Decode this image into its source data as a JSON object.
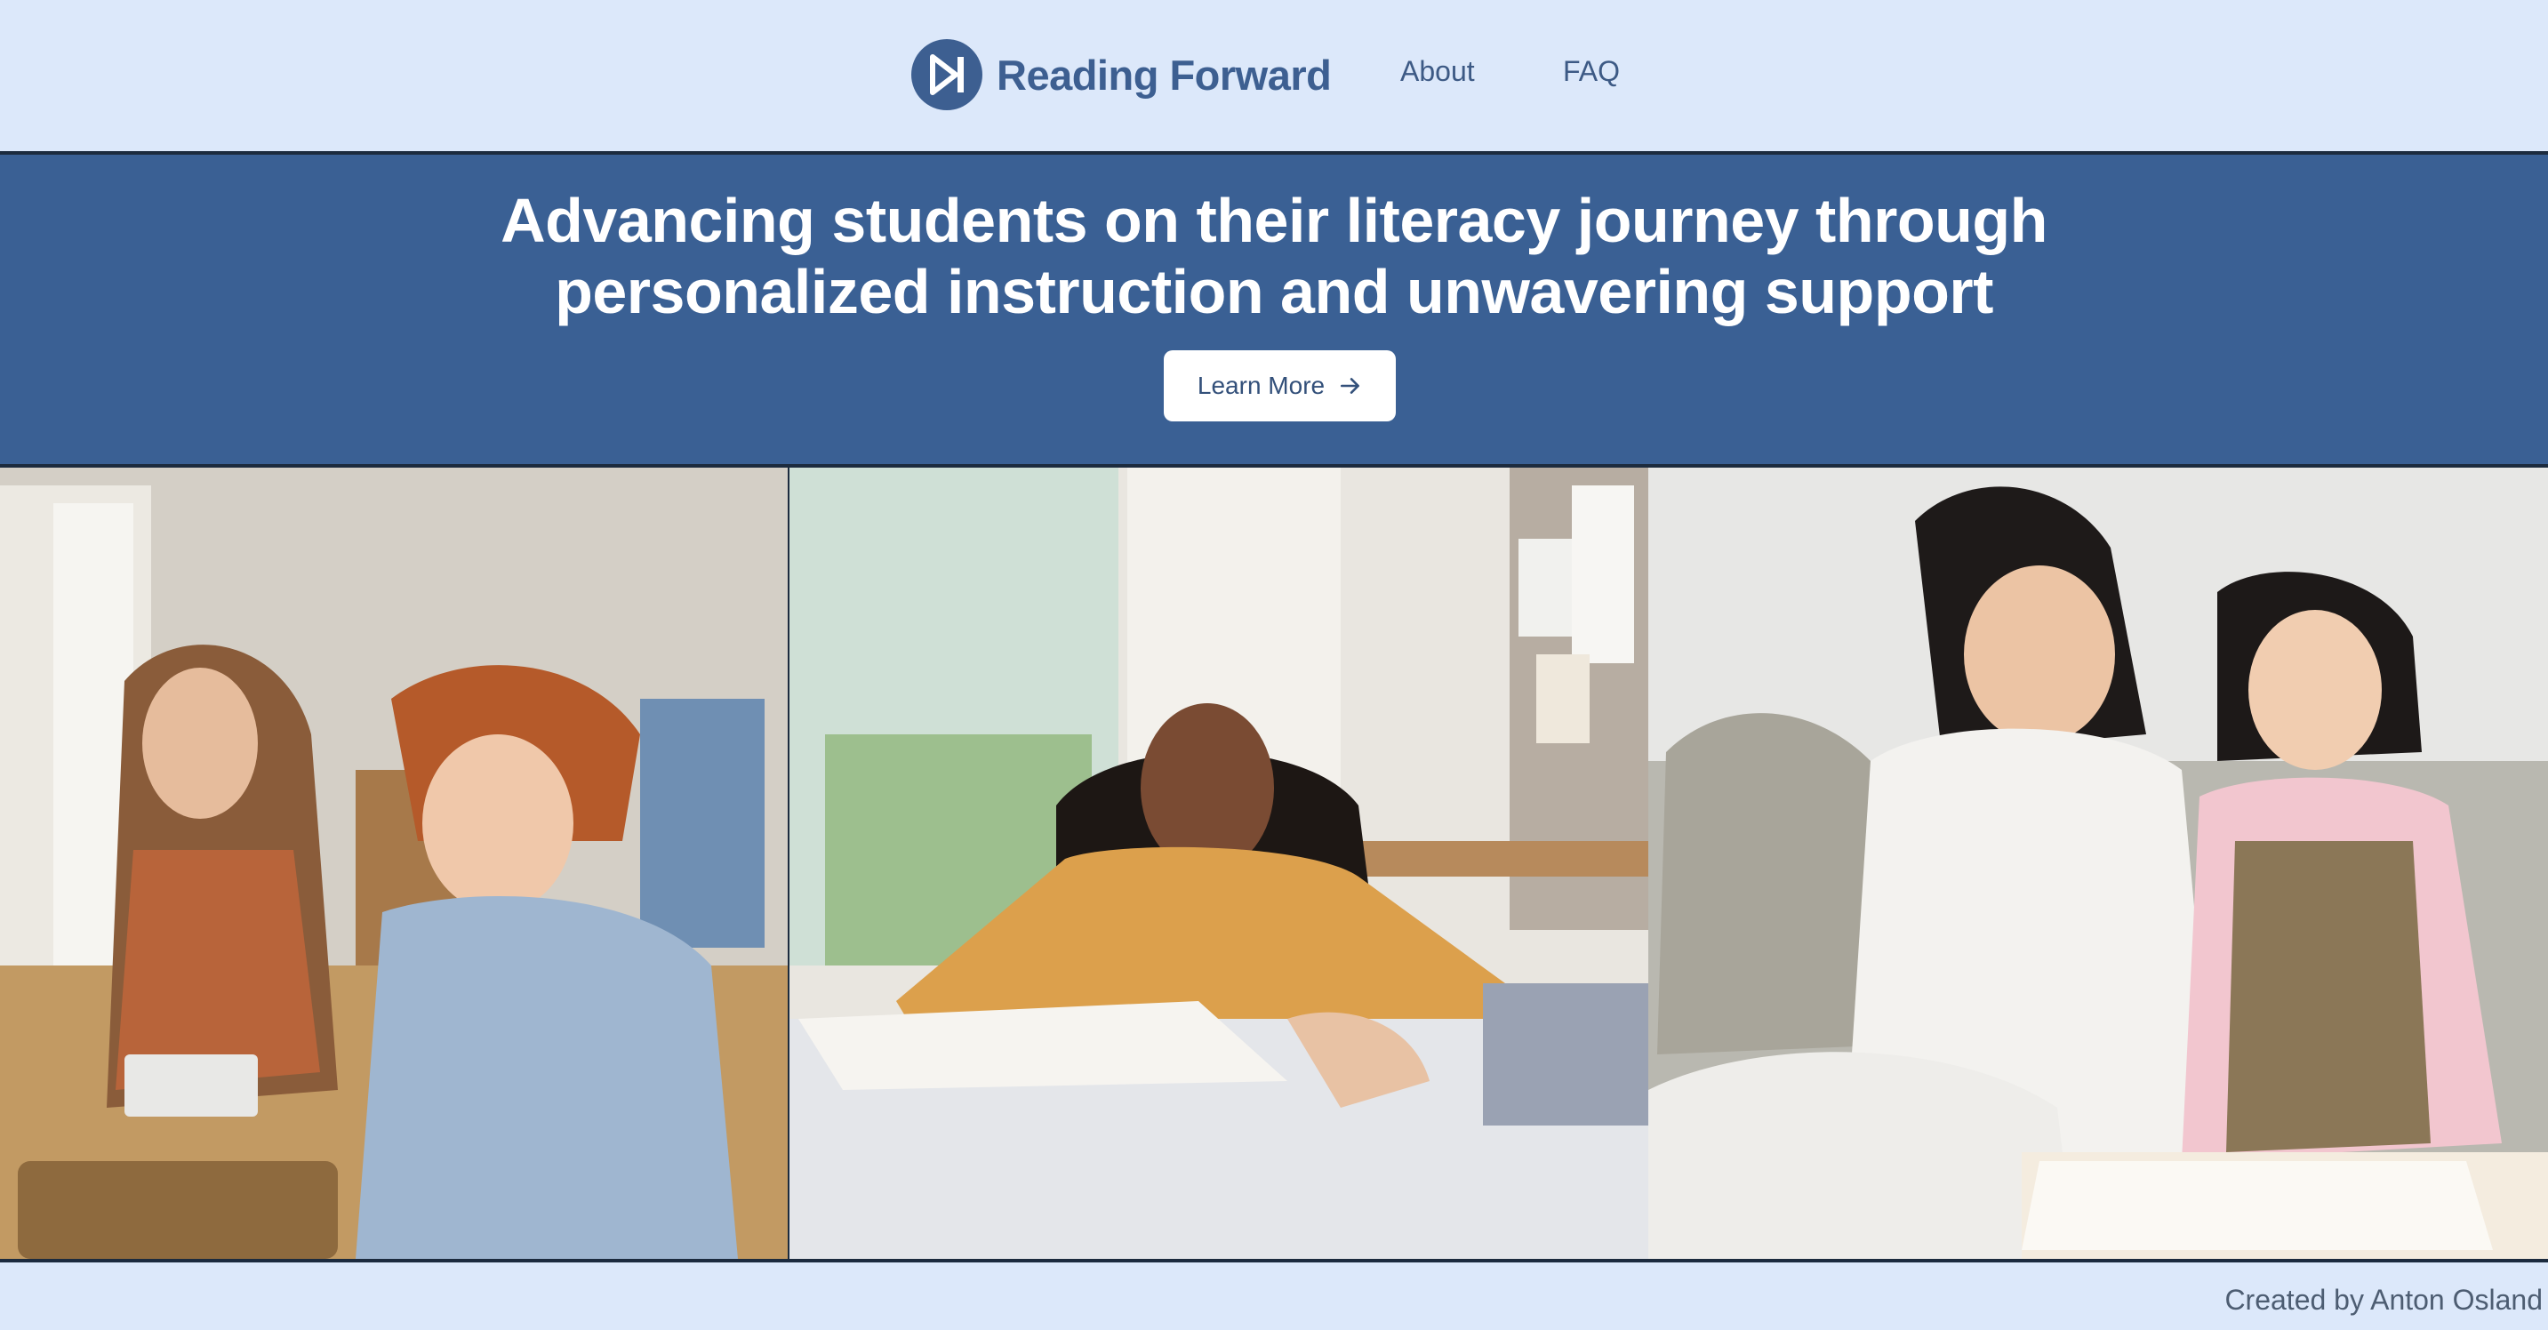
{
  "header": {
    "brand_name": "Reading Forward",
    "logo_icon": "play-skip-forward-icon",
    "nav": [
      {
        "label": "About"
      },
      {
        "label": "FAQ"
      }
    ]
  },
  "hero": {
    "title_line_1": "Advancing students on their literacy journey through",
    "title_line_2": "personalized instruction and unwavering support",
    "cta_label": "Learn More",
    "cta_icon": "arrow-right-icon"
  },
  "photos": [
    {
      "subject": "woman and boy at computer"
    },
    {
      "subject": "student in yellow sweater at table"
    },
    {
      "subject": "woman and girl drawing on couch"
    }
  ],
  "footer": {
    "credit": "Created by Anton Osland"
  },
  "colors": {
    "page_background": "#dce8fa",
    "hero_background": "#3a6094",
    "brand": "#3d5f91",
    "divider": "#1c2b3e"
  }
}
